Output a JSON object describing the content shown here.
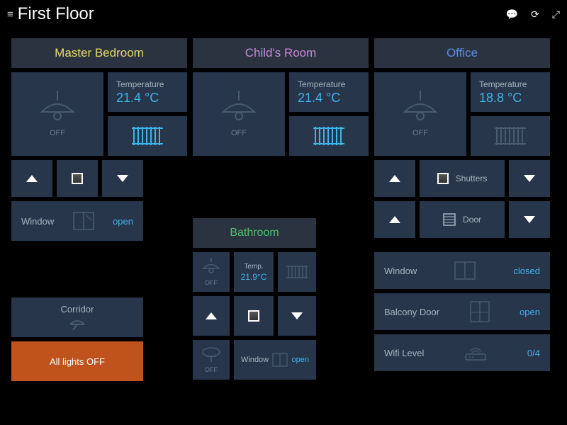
{
  "header": {
    "title": "First Floor"
  },
  "rooms": {
    "master": {
      "name": "Master Bedroom",
      "color": "#e8d96a"
    },
    "child": {
      "name": "Child's Room",
      "color": "#c989d8"
    },
    "office": {
      "name": "Office",
      "color": "#5a8de0"
    },
    "bathroom": {
      "name": "Bathroom",
      "color": "#4cc26a"
    }
  },
  "labels": {
    "temperature": "Temperature",
    "temp_short": "Temp.",
    "off": "OFF",
    "window": "Window",
    "shutters": "Shutters",
    "door": "Door",
    "balcony_door": "Balcony Door",
    "wifi_level": "Wifi Level",
    "corridor": "Corridor",
    "all_lights_off": "All lights OFF"
  },
  "values": {
    "master_temp": "21.4 °C",
    "child_temp": "21.4 °C",
    "office_temp": "18.8 °C",
    "bathroom_temp": "21.9°C",
    "master_window": "open",
    "office_window": "closed",
    "office_balcony": "open",
    "bathroom_window": "open",
    "office_wifi": "0/4"
  },
  "colors": {
    "accent": "#3fb3ea",
    "all_off_bg": "#c0531c"
  }
}
